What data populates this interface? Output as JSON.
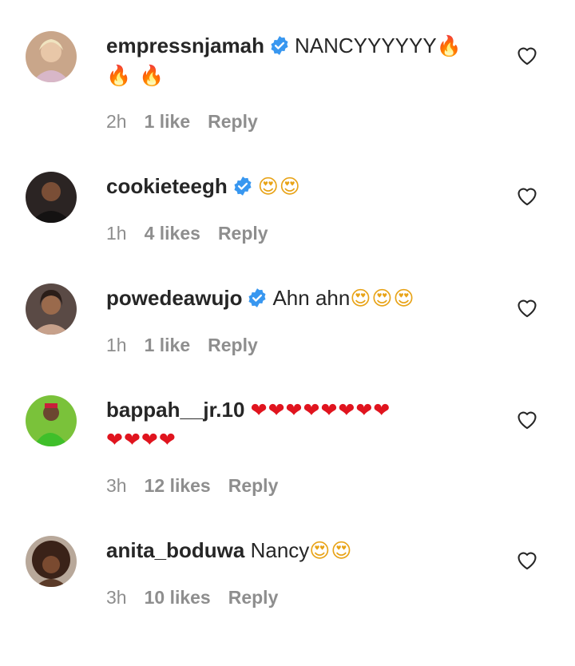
{
  "comments": [
    {
      "username": "empressnjamah",
      "verified": true,
      "text": "NANCYYYYYY",
      "emojis_inline": "🔥",
      "emojis_line2": "🔥 🔥",
      "time": "2h",
      "likes": "1 like",
      "reply": "Reply",
      "avatar_icon": "avatar-photo"
    },
    {
      "username": "cookieteegh",
      "verified": true,
      "text": "",
      "emojis_inline": "😍😍",
      "time": "1h",
      "likes": "4 likes",
      "reply": "Reply",
      "avatar_icon": "avatar-photo"
    },
    {
      "username": "powedeawujo",
      "verified": true,
      "text": "Ahn ahn",
      "emojis_inline": "😍😍😍",
      "time": "1h",
      "likes": "1 like",
      "reply": "Reply",
      "avatar_icon": "avatar-photo"
    },
    {
      "username": "bappah__jr.10",
      "verified": false,
      "text": "",
      "emojis_inline": "❤❤❤❤❤❤❤❤",
      "emojis_line2": "❤❤❤❤",
      "time": "3h",
      "likes": "12 likes",
      "reply": "Reply",
      "avatar_icon": "avatar-photo"
    },
    {
      "username": "anita_boduwa",
      "verified": false,
      "text": "Nancy",
      "emojis_inline": "😍😍",
      "time": "3h",
      "likes": "10 likes",
      "reply": "Reply",
      "avatar_icon": "avatar-photo"
    }
  ],
  "icons": {
    "like": "heart-outline-icon",
    "verified": "verified-badge-icon"
  },
  "colors": {
    "text": "#262626",
    "meta": "#8e8e8e",
    "verified": "#3897f0"
  }
}
